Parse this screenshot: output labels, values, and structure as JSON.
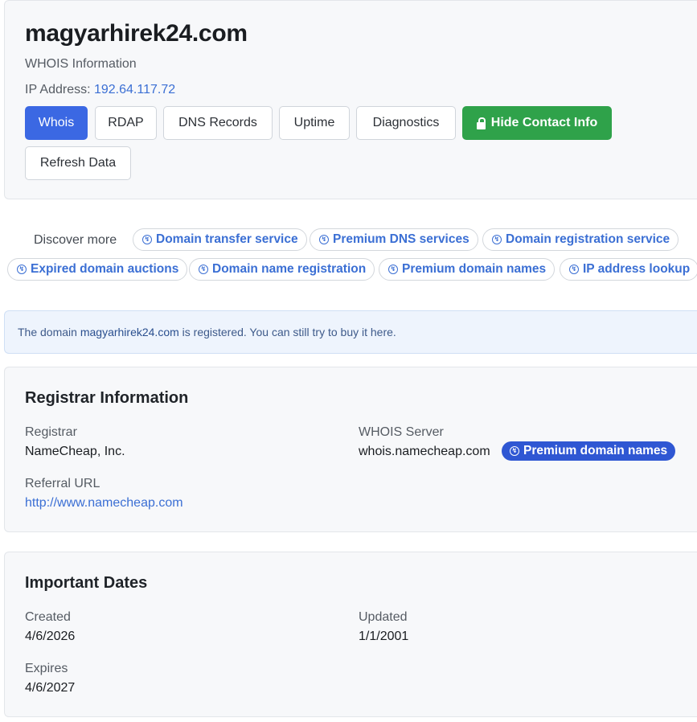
{
  "header": {
    "domain": "magyarhirek24.com",
    "subtitle": "WHOIS Information",
    "ip_label": "IP Address: ",
    "ip_value": "192.64.117.72",
    "tabs": [
      {
        "label": "Whois",
        "active": true
      },
      {
        "label": "RDAP"
      },
      {
        "label": "DNS Records"
      },
      {
        "label": "Uptime"
      },
      {
        "label": "Diagnostics"
      }
    ],
    "hide_contact_label": "Hide Contact Info",
    "refresh_label": "Refresh Data"
  },
  "discover": {
    "label": "Discover more",
    "links": [
      "Domain transfer service",
      "Premium DNS services",
      "Domain registration service",
      "Expired domain auctions",
      "Domain name registration",
      "Premium domain names",
      "IP address lookup"
    ]
  },
  "notice": {
    "prefix": "The domain ",
    "domain": "magyarhirek24.com",
    "suffix": " is registered. You can still try to buy it here."
  },
  "registrar": {
    "title": "Registrar Information",
    "registrar_label": "Registrar",
    "registrar_value": "NameCheap, Inc.",
    "whois_label": "WHOIS Server",
    "whois_value": "whois.namecheap.com",
    "badge": "Premium domain names",
    "referral_label": "Referral URL",
    "referral_value": "http://www.namecheap.com"
  },
  "dates": {
    "title": "Important Dates",
    "created_label": "Created",
    "created_value": "4/6/2026",
    "updated_label": "Updated",
    "updated_value": "1/1/2001",
    "expires_label": "Expires",
    "expires_value": "4/6/2027"
  },
  "colors": {
    "primary": "#3b68e3",
    "success": "#2fa24a",
    "link": "#3b6fd4",
    "badge": "#2f57d3"
  }
}
